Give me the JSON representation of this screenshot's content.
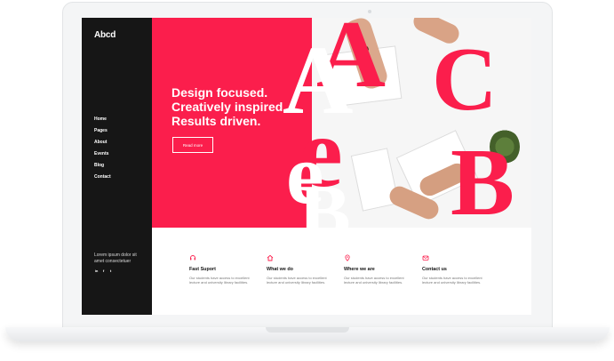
{
  "logo": "Abcd",
  "nav": [
    "Home",
    "Pages",
    "About",
    "Events",
    "Blog",
    "Contact"
  ],
  "sidebar_text": "Lorem ipsum dolor sit amet consectetuer",
  "social_icons": [
    "linkedin-icon",
    "facebook-icon",
    "twitter-icon"
  ],
  "hero": {
    "lines": [
      "Design focused.",
      "Creatively inspired.",
      "Results driven."
    ],
    "button": "Read more"
  },
  "features": [
    {
      "title": "Fast Suport",
      "text": "Our students have access to excellent lecture and university library facilities.",
      "icon": "headset-icon"
    },
    {
      "title": "What we do",
      "text": "Our students have access to excellent lecture and university library facilities.",
      "icon": "home-icon"
    },
    {
      "title": "Where we are",
      "text": "Our students have access to excellent lecture and university library facilities.",
      "icon": "location-pin-icon"
    },
    {
      "title": "Contact us",
      "text": "Our students have access to excellent lecture and university library facilities.",
      "icon": "contact-icon"
    }
  ],
  "colors": {
    "accent": "#fb1e4c",
    "sidebar": "#161616",
    "text": "#121212"
  }
}
